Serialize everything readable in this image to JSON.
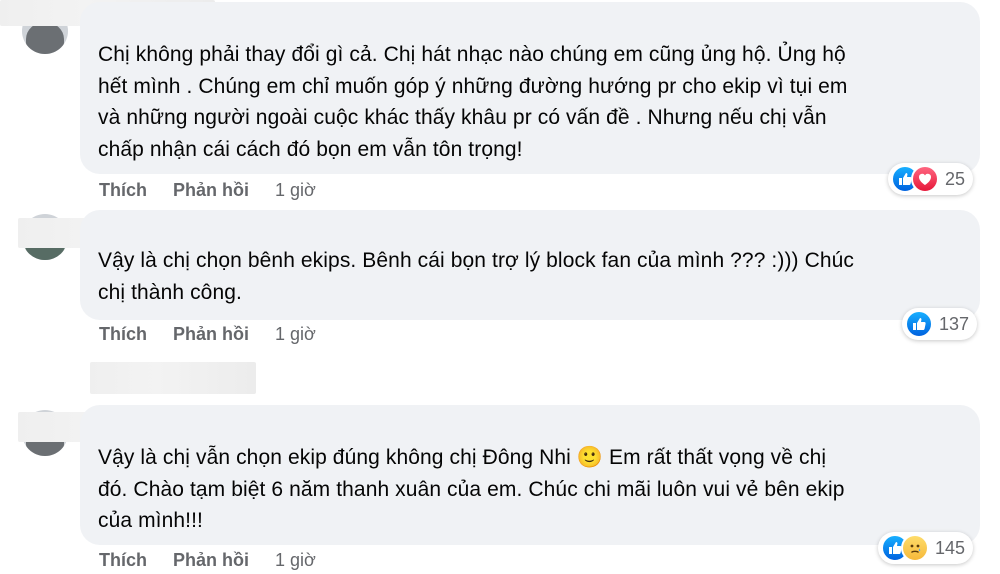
{
  "comments": [
    {
      "text_lines": [
        "Chị không phải thay đổi gì cả. Chị hát nhạc nào chúng em cũng ủng hộ. Ủng hộ",
        "hết mình . Chúng em chỉ muốn góp ý những đường hướng pr cho ekip vì tụi em",
        "và những người ngoài cuộc khác thấy khâu pr có vấn đề . Nhưng nếu chị vẫn",
        "chấp nhận cái cách đó bọn em vẫn tôn trọng!"
      ],
      "like_label": "Thích",
      "reply_label": "Phản hồi",
      "time": "1 giờ",
      "reactions": [
        "like-icon",
        "love-icon"
      ],
      "reaction_count": "25"
    },
    {
      "text_lines": [
        "Vậy là chị chọn bênh ekips. Bênh cái bọn trợ lý block fan của mình ??? :))) Chúc",
        "chị thành công."
      ],
      "like_label": "Thích",
      "reply_label": "Phản hồi",
      "time": "1 giờ",
      "reactions": [
        "like-icon"
      ],
      "reaction_count": "137"
    },
    {
      "text_lines": [
        "Vậy là chị vẫn chọn ekip đúng không chị Đông Nhi 🙂 Em rất thất vọng về chị",
        "đó. Chào tạm biệt 6 năm thanh xuân của em. Chúc chi mãi luôn vui vẻ bên ekip",
        "của mình!!!"
      ],
      "like_label": "Thích",
      "reply_label": "Phản hồi",
      "time": "1 giờ",
      "reactions": [
        "like-icon",
        "sad-icon"
      ],
      "reaction_count": "145"
    }
  ]
}
